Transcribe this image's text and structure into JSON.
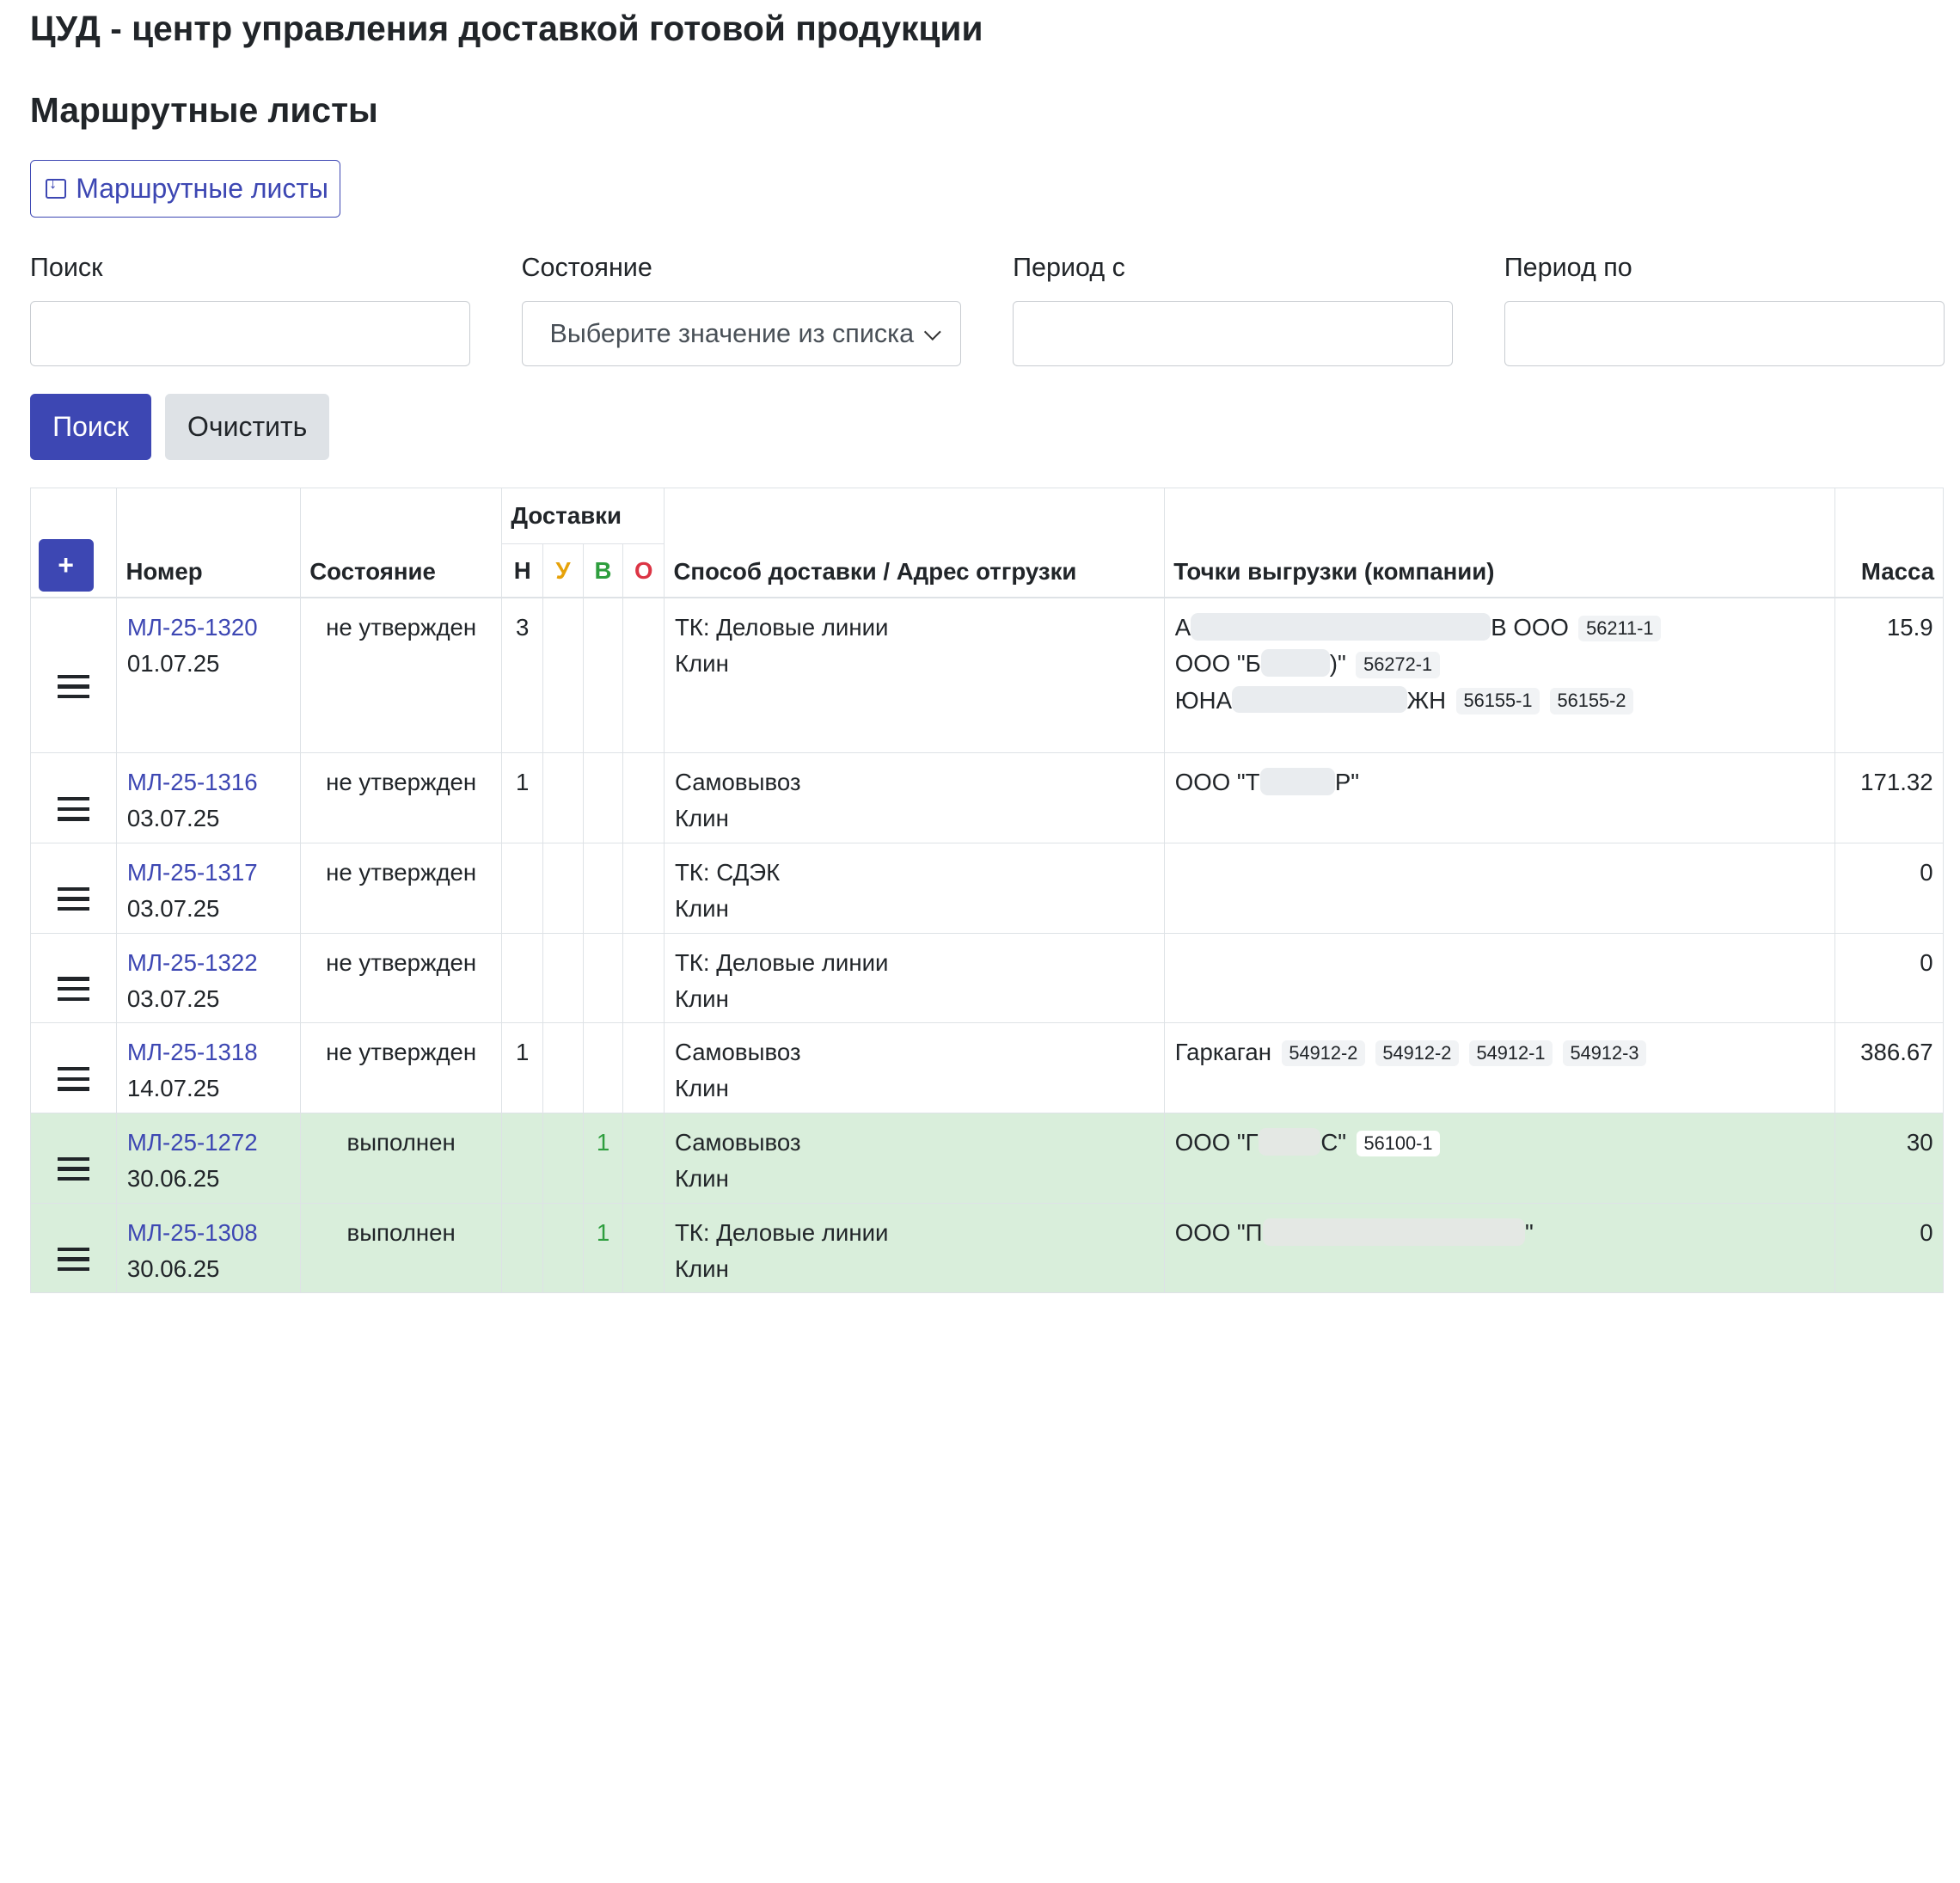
{
  "app_title": "ЦУД - центр управления доставкой готовой продукции",
  "page_title": "Маршрутные листы",
  "export_button": "Маршрутные листы",
  "filters": {
    "search": {
      "label": "Поиск",
      "value": ""
    },
    "state": {
      "label": "Состояние",
      "placeholder": "Выберите значение из списка"
    },
    "period_from": {
      "label": "Период с",
      "value": ""
    },
    "period_to": {
      "label": "Период по",
      "value": ""
    }
  },
  "buttons": {
    "search": "Поиск",
    "clear": "Очистить"
  },
  "table": {
    "add_label": "+",
    "headers": {
      "number": "Номер",
      "state": "Состояние",
      "deliveries": "Доставки",
      "h": "Н",
      "u": "У",
      "v": "В",
      "o": "О",
      "method": "Способ доставки / Адрес отгрузки",
      "points": "Точки выгрузки (компании)",
      "mass": "Масса"
    },
    "rows": [
      {
        "number": "МЛ-25-1320",
        "date": "01.07.25",
        "state": "не утвержден",
        "h": "3",
        "u": "",
        "v": "",
        "o": "",
        "method": "ТК: Деловые линии",
        "address": "Клин",
        "points": [
          {
            "pre": "А",
            "post": "В ООО",
            "badges": [
              "56211-1"
            ]
          },
          {
            "pre": "ООО \"Б",
            "post": ")\"",
            "badges": [
              "56272-1"
            ]
          },
          {
            "pre": "ЮНА",
            "post": "ЖН",
            "badges": [
              "56155-1",
              "56155-2"
            ]
          }
        ],
        "mass": "15.9",
        "done": false
      },
      {
        "number": "МЛ-25-1316",
        "date": "03.07.25",
        "state": "не утвержден",
        "h": "1",
        "u": "",
        "v": "",
        "o": "",
        "method": "Самовывоз",
        "address": "Клин",
        "points": [
          {
            "pre": "ООО \"Т",
            "post": "Р\"",
            "badges": []
          }
        ],
        "mass": "171.32",
        "done": false
      },
      {
        "number": "МЛ-25-1317",
        "date": "03.07.25",
        "state": "не утвержден",
        "h": "",
        "u": "",
        "v": "",
        "o": "",
        "method": "ТК: СДЭК",
        "address": "Клин",
        "points": [],
        "mass": "0",
        "done": false
      },
      {
        "number": "МЛ-25-1322",
        "date": "03.07.25",
        "state": "не утвержден",
        "h": "",
        "u": "",
        "v": "",
        "o": "",
        "method": "ТК: Деловые линии",
        "address": "Клин",
        "points": [],
        "mass": "0",
        "done": false
      },
      {
        "number": "МЛ-25-1318",
        "date": "14.07.25",
        "state": "не утвержден",
        "h": "1",
        "u": "",
        "v": "",
        "o": "",
        "method": "Самовывоз",
        "address": "Клин",
        "points": [
          {
            "pre": "Гаркаган",
            "post": "",
            "badges": [
              "54912-2",
              "54912-2",
              "54912-1",
              "54912-3"
            ]
          }
        ],
        "mass": "386.67",
        "done": false
      },
      {
        "number": "МЛ-25-1272",
        "date": "30.06.25",
        "state": "выполнен",
        "h": "",
        "u": "",
        "v": "1",
        "o": "",
        "method": "Самовывоз",
        "address": "Клин",
        "points": [
          {
            "pre": "ООО \"Г",
            "post": "С\"",
            "badges": [
              "56100-1"
            ]
          }
        ],
        "mass": "30",
        "done": true
      },
      {
        "number": "МЛ-25-1308",
        "date": "30.06.25",
        "state": "выполнен",
        "h": "",
        "u": "",
        "v": "1",
        "o": "",
        "method": "ТК: Деловые линии",
        "address": "Клин",
        "points": [
          {
            "pre": "ООО \"П",
            "post": "\"",
            "badges": []
          }
        ],
        "mass": "0",
        "done": true
      }
    ]
  }
}
